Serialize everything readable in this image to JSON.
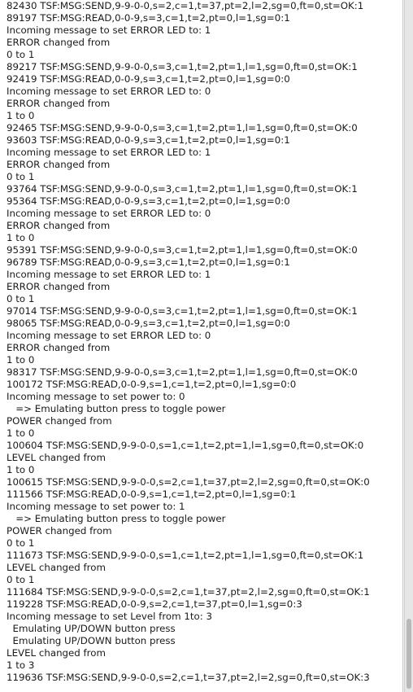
{
  "console": {
    "lines": [
      "82430 TSF:MSG:SEND,9-9-0-0,s=2,c=1,t=37,pt=2,l=2,sg=0,ft=0,st=OK:1",
      "89197 TSF:MSG:READ,0-0-9,s=3,c=1,t=2,pt=0,l=1,sg=0:1",
      "Incoming message to set ERROR LED to: 1",
      "ERROR changed from",
      "0 to 1",
      "89217 TSF:MSG:SEND,9-9-0-0,s=3,c=1,t=2,pt=1,l=1,sg=0,ft=0,st=OK:1",
      "92419 TSF:MSG:READ,0-0-9,s=3,c=1,t=2,pt=0,l=1,sg=0:0",
      "Incoming message to set ERROR LED to: 0",
      "ERROR changed from",
      "1 to 0",
      "92465 TSF:MSG:SEND,9-9-0-0,s=3,c=1,t=2,pt=1,l=1,sg=0,ft=0,st=OK:0",
      "93603 TSF:MSG:READ,0-0-9,s=3,c=1,t=2,pt=0,l=1,sg=0:1",
      "Incoming message to set ERROR LED to: 1",
      "ERROR changed from",
      "0 to 1",
      "93764 TSF:MSG:SEND,9-9-0-0,s=3,c=1,t=2,pt=1,l=1,sg=0,ft=0,st=OK:1",
      "95364 TSF:MSG:READ,0-0-9,s=3,c=1,t=2,pt=0,l=1,sg=0:0",
      "Incoming message to set ERROR LED to: 0",
      "ERROR changed from",
      "1 to 0",
      "95391 TSF:MSG:SEND,9-9-0-0,s=3,c=1,t=2,pt=1,l=1,sg=0,ft=0,st=OK:0",
      "96789 TSF:MSG:READ,0-0-9,s=3,c=1,t=2,pt=0,l=1,sg=0:1",
      "Incoming message to set ERROR LED to: 1",
      "ERROR changed from",
      "0 to 1",
      "97014 TSF:MSG:SEND,9-9-0-0,s=3,c=1,t=2,pt=1,l=1,sg=0,ft=0,st=OK:1",
      "98065 TSF:MSG:READ,0-0-9,s=3,c=1,t=2,pt=0,l=1,sg=0:0",
      "Incoming message to set ERROR LED to: 0",
      "ERROR changed from",
      "1 to 0",
      "98317 TSF:MSG:SEND,9-9-0-0,s=3,c=1,t=2,pt=1,l=1,sg=0,ft=0,st=OK:0",
      "100172 TSF:MSG:READ,0-0-9,s=1,c=1,t=2,pt=0,l=1,sg=0:0",
      "Incoming message to set power to: 0",
      "   => Emulating button press to toggle power",
      "POWER changed from",
      "1 to 0",
      "100604 TSF:MSG:SEND,9-9-0-0,s=1,c=1,t=2,pt=1,l=1,sg=0,ft=0,st=OK:0",
      "LEVEL changed from",
      "1 to 0",
      "100615 TSF:MSG:SEND,9-9-0-0,s=2,c=1,t=37,pt=2,l=2,sg=0,ft=0,st=OK:0",
      "111566 TSF:MSG:READ,0-0-9,s=1,c=1,t=2,pt=0,l=1,sg=0:1",
      "Incoming message to set power to: 1",
      "   => Emulating button press to toggle power",
      "POWER changed from",
      "0 to 1",
      "111673 TSF:MSG:SEND,9-9-0-0,s=1,c=1,t=2,pt=1,l=1,sg=0,ft=0,st=OK:1",
      "LEVEL changed from",
      "0 to 1",
      "111684 TSF:MSG:SEND,9-9-0-0,s=2,c=1,t=37,pt=2,l=2,sg=0,ft=0,st=OK:1",
      "119228 TSF:MSG:READ,0-0-9,s=2,c=1,t=37,pt=0,l=1,sg=0:3",
      "Incoming message to set Level from 1to: 3",
      "  Emulating UP/DOWN button press",
      "  Emulating UP/DOWN button press",
      "LEVEL changed from",
      "1 to 3",
      "119636 TSF:MSG:SEND,9-9-0-0,s=2,c=1,t=37,pt=2,l=2,sg=0,ft=0,st=OK:3"
    ]
  }
}
